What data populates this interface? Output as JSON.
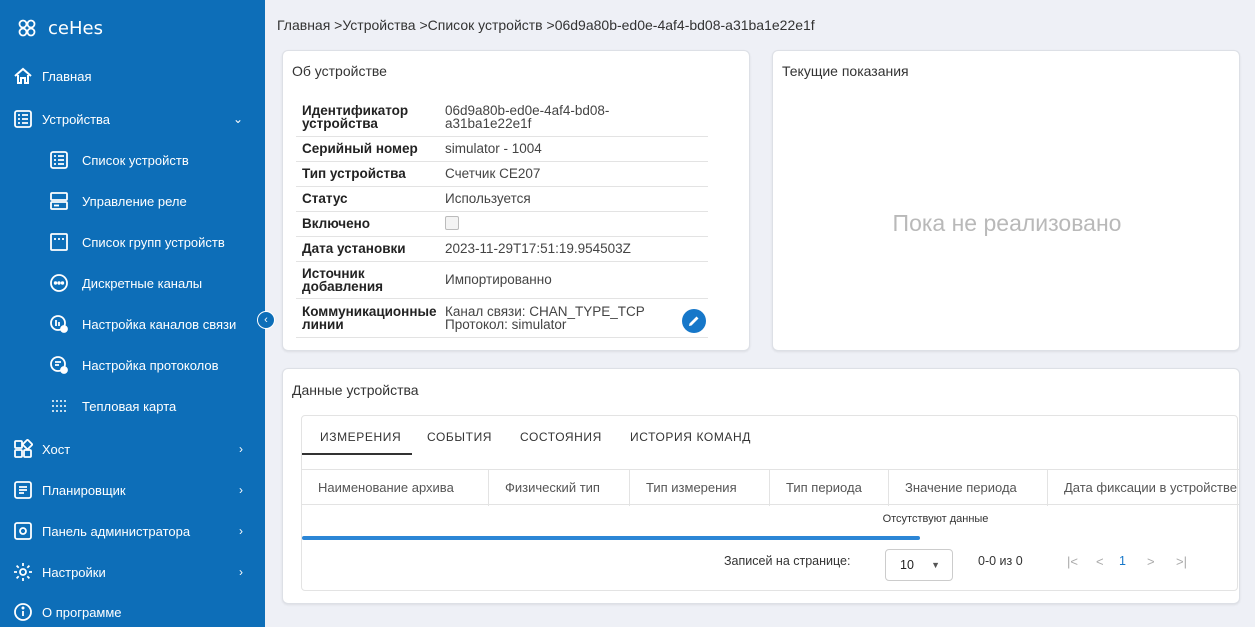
{
  "app": {
    "name": "ceHes"
  },
  "sidebar": {
    "items": [
      {
        "label": "Главная"
      },
      {
        "label": "Устройства",
        "arrow": "⌄"
      },
      {
        "label": "Список устройств"
      },
      {
        "label": "Управление реле"
      },
      {
        "label": "Список групп устройств"
      },
      {
        "label": "Дискретные каналы"
      },
      {
        "label": "Настройка каналов связи"
      },
      {
        "label": "Настройка протоколов"
      },
      {
        "label": "Тепловая карта"
      },
      {
        "label": "Хост",
        "arrow": "›"
      },
      {
        "label": "Планировщик",
        "arrow": "›"
      },
      {
        "label": "Панель администратора",
        "arrow": "›"
      },
      {
        "label": "Настройки",
        "arrow": "›"
      },
      {
        "label": "О программе"
      }
    ],
    "collapse": "‹"
  },
  "breadcrumb": "Главная >Устройства >Список устройств >06d9a80b-ed0e-4af4-bd08-a31ba1e22e1f",
  "about": {
    "title": "Об устройстве",
    "rows": [
      {
        "k1": "Идентификатор",
        "k2": "устройства",
        "v1": "06d9a80b-ed0e-4af4-bd08-",
        "v2": "a31ba1e22e1f"
      },
      {
        "k1": "Серийный номер",
        "v1": "simulator - 1004"
      },
      {
        "k1": "Тип устройства",
        "v1": "Счетчик CE207"
      },
      {
        "k1": "Статус",
        "v1": "Используется"
      },
      {
        "k1": "Включено"
      },
      {
        "k1": "Дата установки",
        "v1": "2023-11-29T17:51:19.954503Z"
      },
      {
        "k1": "Источник",
        "k2": "добавления",
        "v1": "Импортированно"
      },
      {
        "k1": "Коммуникационные",
        "k2": "линии",
        "v1": "Канал связи: CHAN_TYPE_TCP",
        "v2": "Протокол: simulator"
      }
    ],
    "enabled": false
  },
  "current": {
    "title": "Текущие показания",
    "placeholder": "Пока не реализовано"
  },
  "device_data": {
    "title": "Данные устройства",
    "tabs": [
      "ИЗМЕРЕНИЯ",
      "СОБЫТИЯ",
      "СОСТОЯНИЯ",
      "ИСТОРИЯ КОМАНД"
    ],
    "columns": [
      "Наименование архива",
      "Физический тип",
      "Тип измерения",
      "Тип периода",
      "Значение периода",
      "Дата фиксации в устройстве"
    ],
    "empty": "Отсутствуют данные",
    "progress": 0.66,
    "pager": {
      "per_page_label": "Записей на странице:",
      "per_page": "10",
      "range": "0-0 из 0",
      "page": "1"
    }
  },
  "colors": {
    "sidebar": "#0d6eb8",
    "accent": "#1677c9",
    "progress": "#2c86d6"
  }
}
